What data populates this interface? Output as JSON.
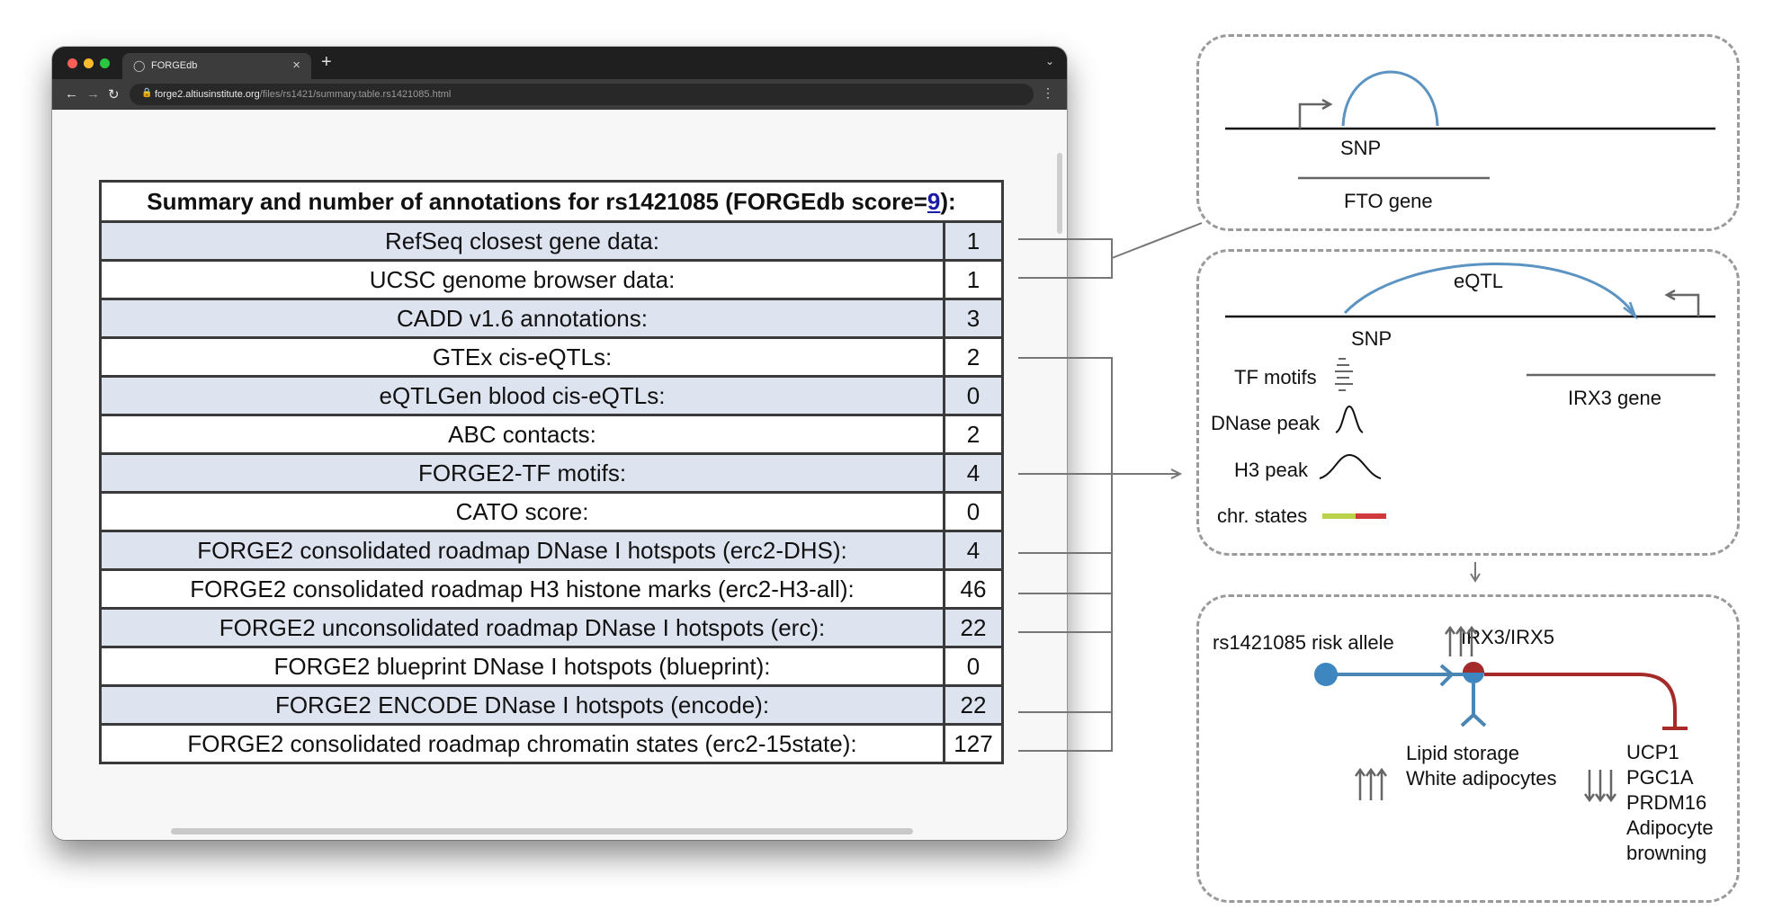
{
  "browser": {
    "tab_title": "FORGEdb",
    "tab_close": "×",
    "new_tab": "+",
    "tab_menu": "⌄",
    "url_host": "forge2.altiusinstitute.org",
    "url_path": "/files/rs1421/summary.table.rs1421085.html",
    "menu": "⋮"
  },
  "table": {
    "title_prefix": "Summary and number of annotations for rs1421085 (FORGEdb score=",
    "score": "9",
    "title_suffix": "):",
    "rows": [
      {
        "label": "RefSeq closest gene data:",
        "value": "1"
      },
      {
        "label": "UCSC genome browser data:",
        "value": "1"
      },
      {
        "label": "CADD v1.6 annotations:",
        "value": "3"
      },
      {
        "label": "GTEx cis-eQTLs:",
        "value": "2"
      },
      {
        "label": "eQTLGen blood cis-eQTLs:",
        "value": "0"
      },
      {
        "label": "ABC contacts:",
        "value": "2"
      },
      {
        "label": "FORGE2-TF motifs:",
        "value": "4"
      },
      {
        "label": "CATO score:",
        "value": "0"
      },
      {
        "label": "FORGE2 consolidated roadmap DNase I hotspots (erc2-DHS):",
        "value": "4"
      },
      {
        "label": "FORGE2 consolidated roadmap H3 histone marks (erc2-H3-all):",
        "value": "46"
      },
      {
        "label": "FORGE2 unconsolidated roadmap DNase I hotspots (erc):",
        "value": "22"
      },
      {
        "label": "FORGE2 blueprint DNase I hotspots (blueprint):",
        "value": "0"
      },
      {
        "label": "FORGE2 ENCODE DNase I hotspots (encode):",
        "value": "22"
      },
      {
        "label": "FORGE2 consolidated roadmap chromatin states (erc2-15state):",
        "value": "127"
      }
    ]
  },
  "panel1": {
    "snp": "SNP",
    "gene": "FTO gene"
  },
  "panel2": {
    "eqtl": "eQTL",
    "snp": "SNP",
    "tf_motifs": "TF motifs",
    "gene": "IRX3 gene",
    "dnase_peak": "DNase peak",
    "h3_peak": "H3 peak",
    "chr_states": "chr. states"
  },
  "panel3": {
    "risk_allele": "rs1421085 risk allele",
    "irx": "IRX3/IRX5",
    "lipid": "Lipid storage",
    "white": "White adipocytes",
    "targets": [
      "UCP1",
      "PGC1A",
      "PRDM16",
      "Adipocyte",
      "browning"
    ]
  },
  "colors": {
    "row_shade": "#dde3ef",
    "arc_blue": "#5b93c2",
    "node_blue": "#3d86c0",
    "inhibit_red": "#a52a2a",
    "chr_green": "#b9d24a",
    "chr_red": "#d0393b",
    "link_blue": "#1a1aa6"
  },
  "icons": {
    "lock": "lock-icon",
    "back": "arrow-left-icon",
    "forward": "arrow-right-icon",
    "reload": "reload-icon",
    "favicon": "globe-icon"
  }
}
